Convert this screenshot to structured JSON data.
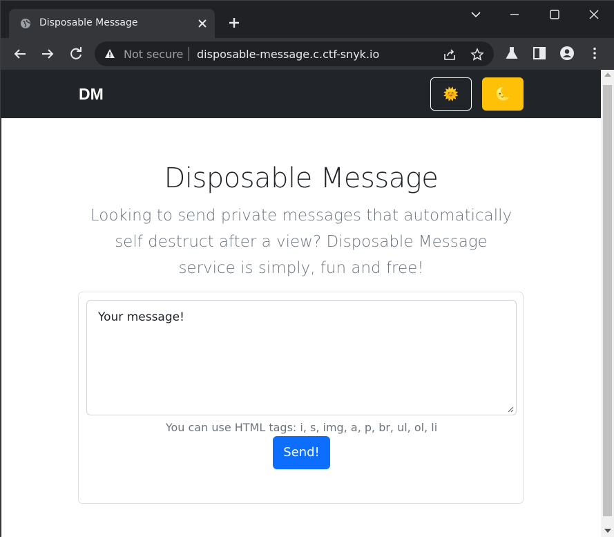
{
  "browser": {
    "tab_title": "Disposable Message",
    "tab_favicon": "globe-icon",
    "security_label": "Not secure",
    "url": "disposable-message.c.ctf-snyk.io",
    "colors": {
      "chrome_dark": "#202124",
      "chrome_toolbar": "#35363a",
      "text": "#e8eaed"
    }
  },
  "navbar": {
    "brand": "DM",
    "light_theme_icon": "🌞",
    "dark_theme_icon": "🌜",
    "colors": {
      "bg": "#212529",
      "dark_btn": "#ffc107"
    }
  },
  "main": {
    "heading": "Disposable Message",
    "lead": "Looking to send private messages that automatically self destruct after a view? Disposable Message service is simply, fun and free!",
    "message_placeholder": "Your message!",
    "help_text": "You can use HTML tags: i, s, img, a, p, br, ul, ol, li",
    "send_label": "Send!",
    "colors": {
      "primary": "#0d6efd",
      "muted": "#6c757d"
    }
  }
}
